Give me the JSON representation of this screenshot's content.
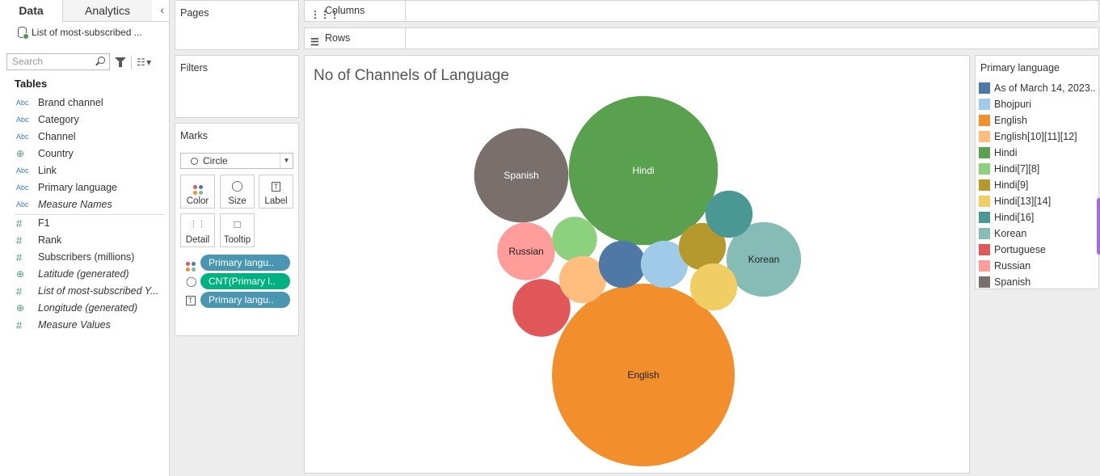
{
  "data_pane": {
    "tabs": [
      "Data",
      "Analytics"
    ],
    "collapse_icon": "chevron-left-icon",
    "datasource": "List of most-subscribed ...",
    "search_placeholder": "Search",
    "tables_title": "Tables",
    "dimensions": [
      {
        "type": "Abc",
        "name": "Brand channel"
      },
      {
        "type": "Abc",
        "name": "Category"
      },
      {
        "type": "Abc",
        "name": "Channel"
      },
      {
        "type": "globe",
        "name": "Country"
      },
      {
        "type": "Abc",
        "name": "Link"
      },
      {
        "type": "Abc",
        "name": "Primary language"
      },
      {
        "type": "Abc",
        "name": "Measure Names",
        "italic": true
      }
    ],
    "measures": [
      {
        "type": "#",
        "name": "F1"
      },
      {
        "type": "#",
        "name": "Rank"
      },
      {
        "type": "#",
        "name": "Subscribers (millions)"
      },
      {
        "type": "globe",
        "name": "Latitude (generated)",
        "italic": true
      },
      {
        "type": "#",
        "name": "List of most-subscribed Y...",
        "italic": true
      },
      {
        "type": "globe",
        "name": "Longitude (generated)",
        "italic": true
      },
      {
        "type": "#",
        "name": "Measure Values",
        "italic": true
      }
    ]
  },
  "cards": {
    "pages": "Pages",
    "filters": "Filters",
    "marks": "Marks",
    "mark_type": "Circle",
    "mark_buttons": [
      "Color",
      "Size",
      "Label",
      "Detail",
      "Tooltip"
    ],
    "pills": [
      {
        "icon": "color-icon",
        "label": "Primary langu..",
        "color": "#4996b2"
      },
      {
        "icon": "size-icon",
        "label": "CNT(Primary l..",
        "color": "#00b180"
      },
      {
        "icon": "label-icon",
        "label": "Primary langu..",
        "color": "#4996b2"
      }
    ]
  },
  "shelves": {
    "columns": "Columns",
    "rows": "Rows"
  },
  "viz_title": "No of Channels of Language",
  "chart_data": {
    "type": "packed-bubble",
    "title": "No of Channels of Language",
    "size_measure": "CNT(Primary language)",
    "color_dimension": "Primary language",
    "bubbles": [
      {
        "name": "English",
        "label": "English",
        "value": 15,
        "color": "#f28e2b"
      },
      {
        "name": "Hindi",
        "label": "Hindi",
        "value": 10,
        "color": "#59a14f"
      },
      {
        "name": "Spanish",
        "label": "Spanish",
        "value": 4,
        "color": "#79706e"
      },
      {
        "name": "Korean",
        "label": "Korean",
        "value": 2.5,
        "color": "#86bcb6"
      },
      {
        "name": "Russian",
        "label": "Russian",
        "value": 1.5,
        "color": "#ff9d9a"
      },
      {
        "name": "Portuguese",
        "label": "",
        "value": 1.5,
        "color": "#e15759"
      },
      {
        "name": "Hindi[7][8]",
        "label": "",
        "value": 1,
        "color": "#8cd17d"
      },
      {
        "name": "English[10][11][12]",
        "label": "",
        "value": 1,
        "color": "#ffbe7d"
      },
      {
        "name": "As of March 14, 2023..",
        "label": "",
        "value": 1,
        "color": "#4e79a7"
      },
      {
        "name": "Bhojpuri",
        "label": "",
        "value": 1,
        "color": "#a0cbe8"
      },
      {
        "name": "Hindi[9]",
        "label": "",
        "value": 1,
        "color": "#b6992d"
      },
      {
        "name": "Hindi[16]",
        "label": "",
        "value": 1,
        "color": "#499894"
      },
      {
        "name": "Hindi[13][14]",
        "label": "",
        "value": 1,
        "color": "#f1ce63"
      }
    ]
  },
  "legend": {
    "title": "Primary language",
    "items": [
      {
        "label": "As of March 14, 2023..",
        "color": "#4e79a7"
      },
      {
        "label": "Bhojpuri",
        "color": "#a0cbe8"
      },
      {
        "label": "English",
        "color": "#f28e2b"
      },
      {
        "label": "English[10][11][12]",
        "color": "#ffbe7d"
      },
      {
        "label": "Hindi",
        "color": "#59a14f"
      },
      {
        "label": "Hindi[7][8]",
        "color": "#8cd17d"
      },
      {
        "label": "Hindi[9]",
        "color": "#b6992d"
      },
      {
        "label": "Hindi[13][14]",
        "color": "#f1ce63"
      },
      {
        "label": "Hindi[16]",
        "color": "#499894"
      },
      {
        "label": "Korean",
        "color": "#86bcb6"
      },
      {
        "label": "Portuguese",
        "color": "#e15759"
      },
      {
        "label": "Russian",
        "color": "#ff9d9a"
      },
      {
        "label": "Spanish",
        "color": "#79706e"
      }
    ]
  }
}
